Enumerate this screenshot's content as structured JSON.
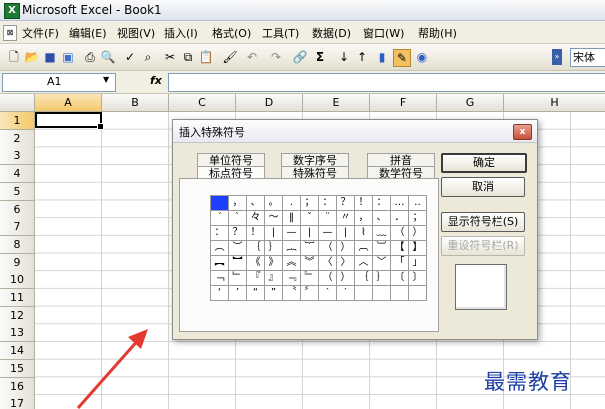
{
  "window": {
    "title": "Microsoft Excel - Book1",
    "app_icon": "X"
  },
  "menu": [
    "文件(F)",
    "编辑(E)",
    "视图(V)",
    "插入(I)",
    "格式(O)",
    "工具(T)",
    "数据(D)",
    "窗口(W)",
    "帮助(H)"
  ],
  "toolbar": {
    "font_name": "宋体"
  },
  "formula_bar": {
    "cell_ref": "A1",
    "fx": "fx",
    "value": ""
  },
  "columns": [
    "A",
    "B",
    "C",
    "D",
    "E",
    "F",
    "G",
    "H"
  ],
  "rows": [
    "1",
    "2",
    "3",
    "4",
    "5",
    "6",
    "7",
    "8",
    "9",
    "10",
    "11",
    "12",
    "13",
    "14",
    "15",
    "16",
    "17"
  ],
  "dialog": {
    "title": "插入特殊符号",
    "close": "x",
    "tabs_back": [
      "单位符号",
      "数字序号",
      "拼音"
    ],
    "tabs_front": [
      "标点符号",
      "特殊符号",
      "数学符号"
    ],
    "symbols": [
      [
        "",
        "，",
        "、",
        "。",
        ".",
        "；",
        "：",
        "？",
        "！",
        "：",
        "…",
        "‥"
      ],
      [
        "ˊ",
        "ˋ",
        "々",
        "～",
        "‖",
        "ˇ",
        "¨",
        "〃",
        "，",
        "、",
        "．",
        "；"
      ],
      [
        "：",
        "？",
        "！",
        "|",
        "—",
        "|",
        "—",
        "|",
        "⌇",
        "﹏",
        "（",
        "）"
      ],
      [
        "︵",
        "︶",
        "｛",
        "｝",
        "︷",
        "︸",
        "（",
        "）",
        "︹",
        "︺",
        "【",
        "】"
      ],
      [
        "︻",
        "︼",
        "《",
        "》",
        "︽",
        "︾",
        "〈",
        "〉",
        "︿",
        "﹀",
        "「",
        "」"
      ],
      [
        "﹁",
        "﹂",
        "『",
        "』",
        "﹃",
        "﹄",
        "（",
        "）",
        "｛",
        "｝",
        "〔",
        "〕"
      ],
      [
        "‘",
        "’",
        "“",
        "”",
        "〝",
        "〞",
        "‵",
        "′",
        "",
        "",
        "",
        ""
      ]
    ],
    "buttons": {
      "ok": "确定",
      "cancel": "取消",
      "show_bar": "显示符号栏(S)",
      "reset_bar": "重设符号栏(R)"
    }
  },
  "watermark": "最需教育",
  "colors": {
    "arrow": "#e23a2e",
    "selected_symbol": "#1f3fff",
    "watermark": "#1d3fa6"
  }
}
